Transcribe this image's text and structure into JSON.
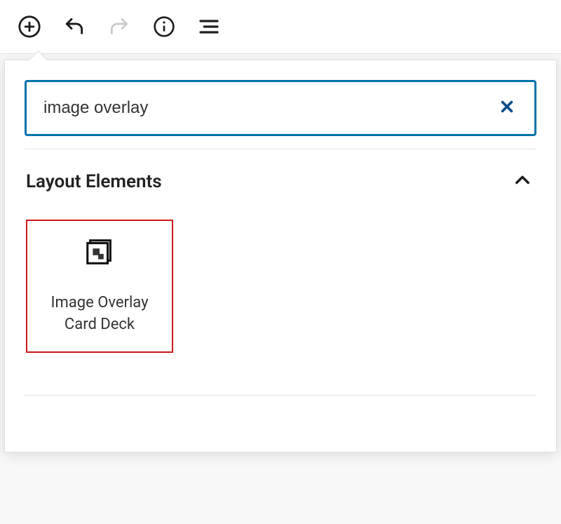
{
  "search": {
    "value": "image overlay"
  },
  "section": {
    "title": "Layout Elements"
  },
  "block": {
    "label": "Image Overlay Card Deck"
  }
}
